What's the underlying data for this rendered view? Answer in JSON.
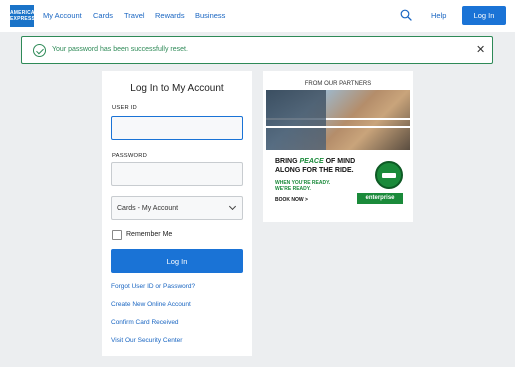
{
  "header": {
    "logo_text": "AMERICAN EXPRESS",
    "nav": [
      "My Account",
      "Cards",
      "Travel",
      "Rewards",
      "Business"
    ],
    "help_label": "Help",
    "login_label": "Log In"
  },
  "alert": {
    "message": "Your password has been successfully reset.",
    "close_glyph": "✕",
    "color": "#2e8a57"
  },
  "login_card": {
    "title": "Log In to My Account",
    "user_id_label": "USER ID",
    "user_id_value": "",
    "password_label": "PASSWORD",
    "password_value": "",
    "account_type_selected": "Cards - My Account",
    "remember_label": "Remember Me",
    "remember_checked": false,
    "login_button": "Log In",
    "links": [
      "Forgot User ID or Password?",
      "Create New Online Account",
      "Confirm Card Received",
      "Visit Our Security Center"
    ]
  },
  "ad": {
    "header": "FROM OUR PARTNERS",
    "headline_1": "BRING ",
    "headline_em": "PEACE",
    "headline_2": " OF MIND",
    "headline_3": "ALONG FOR THE RIDE.",
    "sub_1": "WHEN YOU'RE READY.",
    "sub_2": "WE'RE READY.",
    "cta": "BOOK NOW >",
    "brand": "enterprise"
  },
  "colors": {
    "accent": "#1a73d6",
    "link": "#1a66c2",
    "background": "#eceef0"
  }
}
